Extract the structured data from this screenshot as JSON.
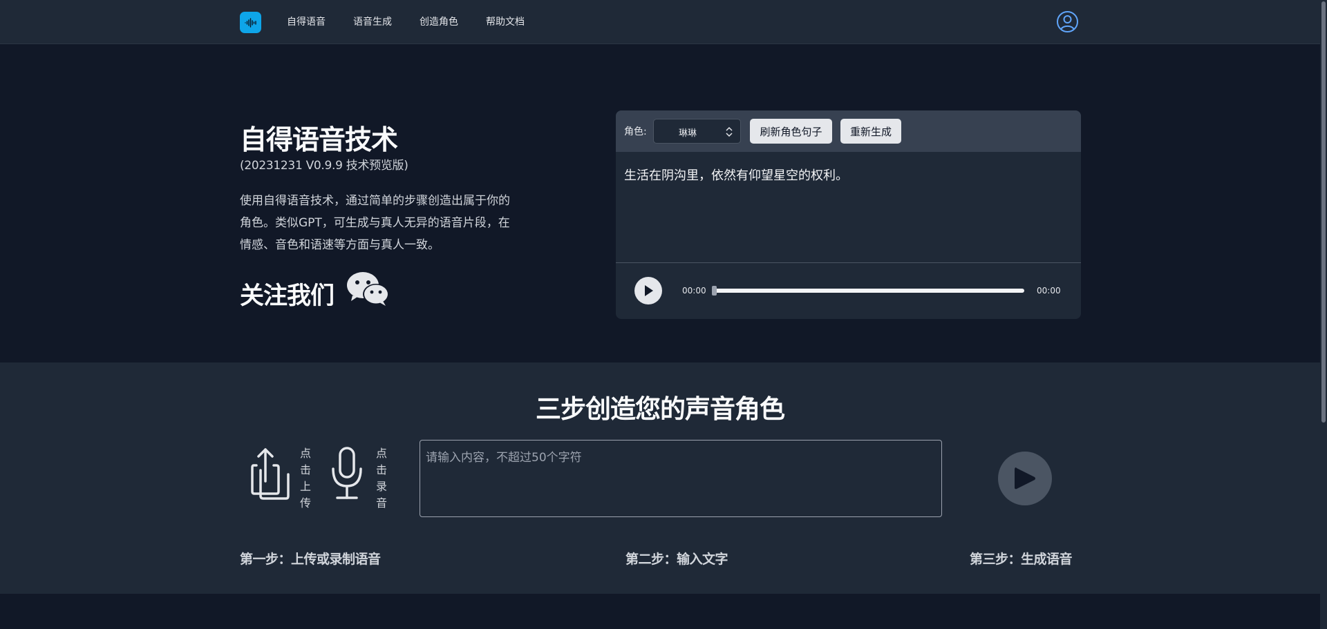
{
  "nav": {
    "links": [
      "自得语音",
      "语音生成",
      "创造角色",
      "帮助文档"
    ],
    "logo_icon": "waveform-icon",
    "user_icon": "user-circle-icon"
  },
  "hero": {
    "title": "自得语音技术",
    "version": "(20231231 V0.9.9 技术预览版)",
    "description": "使用自得语音技术，通过简单的步骤创造出属于你的角色。类似GPT，可生成与真人无异的语音片段，在情感、音色和语速等方面与真人一致。",
    "follow": "关注我们",
    "follow_icon": "wechat-icon"
  },
  "player": {
    "role_label": "角色:",
    "role_value": "琳琳",
    "refresh_label": "刷新角色句子",
    "regenerate_label": "重新生成",
    "sentence": "生活在阴沟里，依然有仰望星空的权利。",
    "current_time": "00:00",
    "duration": "00:00",
    "progress": 0
  },
  "steps": {
    "title": "三步创造您的声音角色",
    "upload_label": "点击上传",
    "record_label": "点击录音",
    "input_placeholder": "请输入内容，不超过50个字符",
    "step1": "第一步：上传或录制语音",
    "step2": "第二步：输入文字",
    "step3": "第三步：生成语音"
  },
  "colors": {
    "background": "#111827",
    "panel": "#1f2937",
    "toolbar": "#374151",
    "accent": "#0ea5e9",
    "user_icon": "#60a5fa"
  }
}
